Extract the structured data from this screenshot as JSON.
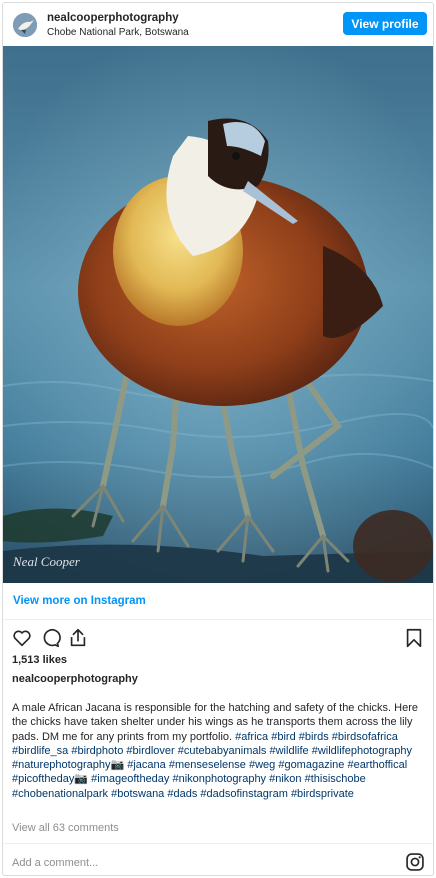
{
  "header": {
    "username": "nealcooperphotography",
    "location": "Chobe National Park, Botswana",
    "view_profile_label": "View profile"
  },
  "photo": {
    "watermark": "Neal Cooper",
    "subject": "African Jacana bird standing on water"
  },
  "view_more_label": "View more on Instagram",
  "likes": "1,513 likes",
  "owner_username": "nealcooperphotography",
  "caption": {
    "text": "A male African Jacana is responsible for the hatching and safety of the chicks. Here the chicks have taken shelter under his wings as he transports them across the lily pads. DM me for any prints from my portfolio.",
    "hashtags": [
      "#africa",
      "#bird",
      "#birds",
      "#birdsofafrica",
      "#birdlife_sa",
      "#birdphoto",
      "#birdlover",
      "#cutebabyanimals",
      "#wildlife",
      "#wildlifephotography",
      "#naturephotography📷",
      "#jacana",
      "#menseselense",
      "#weg",
      "#gomagazine",
      "#earthoffical",
      "#picoftheday📷",
      "#imageoftheday",
      "#nikonphotography",
      "#nikon",
      "#thisischobe",
      "#chobenationalpark",
      "#botswana",
      "#dads",
      "#dadsofinstagram",
      "#birdsprivate"
    ]
  },
  "view_comments_label": "View all 63 comments",
  "add_comment_placeholder": "Add a comment...",
  "icons": {
    "like": "heart-icon",
    "comment": "comment-icon",
    "share": "share-icon",
    "save": "bookmark-icon",
    "brand": "instagram-icon"
  },
  "colors": {
    "accent": "#0095f6",
    "hashtag": "#00376b",
    "muted": "#8e8e8e"
  }
}
